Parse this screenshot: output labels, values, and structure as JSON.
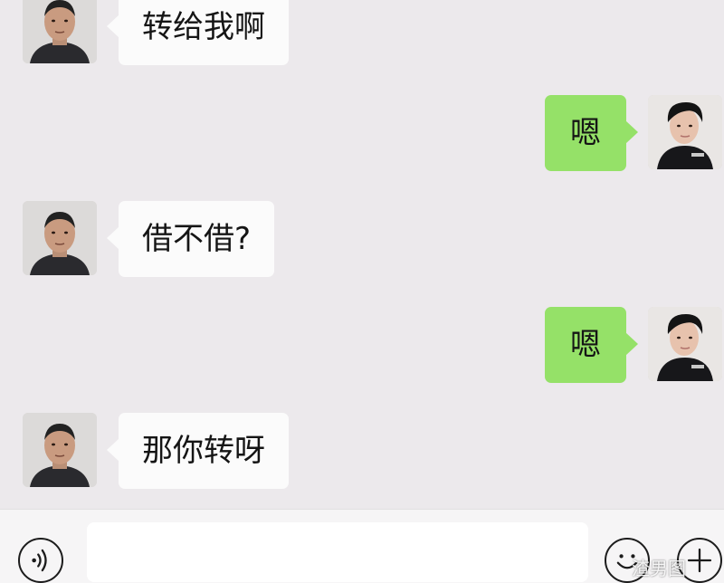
{
  "messages": [
    {
      "side": "left",
      "text": "转给我啊",
      "avatar": "man-avatar"
    },
    {
      "side": "right",
      "text": "嗯",
      "avatar": "self-avatar"
    },
    {
      "side": "left",
      "text": "借不借?",
      "avatar": "man-avatar"
    },
    {
      "side": "right",
      "text": "嗯",
      "avatar": "self-avatar"
    },
    {
      "side": "left",
      "text": "那你转呀",
      "avatar": "man-avatar"
    }
  ],
  "input_bar": {
    "voice_icon": "voice-icon",
    "emoji_icon": "smiley-icon",
    "plus_icon": "plus-icon",
    "input_value": ""
  },
  "watermark": "渣男图",
  "colors": {
    "sent_bubble": "#95e168",
    "received_bubble": "#fbfbfb",
    "background": "#ece9ec"
  }
}
